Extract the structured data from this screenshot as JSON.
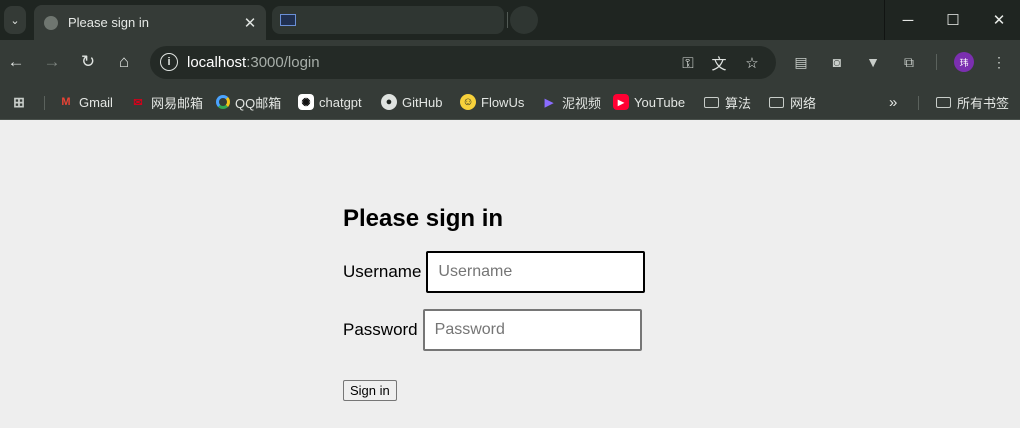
{
  "browser": {
    "tabs": [
      {
        "title": "Please sign in",
        "active": true
      },
      {
        "title": "",
        "active": false
      }
    ],
    "url_host": "localhost",
    "url_path": ":3000/login",
    "bookmarks": [
      {
        "label": "Gmail",
        "icon": "gmail-icon"
      },
      {
        "label": "网易邮箱",
        "icon": "netease-mail-icon"
      },
      {
        "label": "QQ邮箱",
        "icon": "qq-mail-icon"
      },
      {
        "label": "chatgpt",
        "icon": "chatgpt-icon"
      },
      {
        "label": "GitHub",
        "icon": "github-icon"
      },
      {
        "label": "FlowUs",
        "icon": "flowus-icon"
      },
      {
        "label": "泥视频",
        "icon": "video-icon"
      },
      {
        "label": "YouTube",
        "icon": "youtube-icon"
      },
      {
        "label": "算法",
        "icon": "folder-icon"
      },
      {
        "label": "网络",
        "icon": "folder-icon"
      }
    ],
    "all_bookmarks_label": "所有书签",
    "avatar_initial": "玮",
    "colors": {
      "titlebar": "#1f2521",
      "toolbar": "#353b37",
      "omnibox": "#242a26",
      "page_bg": "#eeeeee"
    }
  },
  "login": {
    "heading": "Please sign in",
    "username_label": "Username",
    "username_placeholder": "Username",
    "password_label": "Password",
    "password_placeholder": "Password",
    "submit_label": "Sign in"
  }
}
